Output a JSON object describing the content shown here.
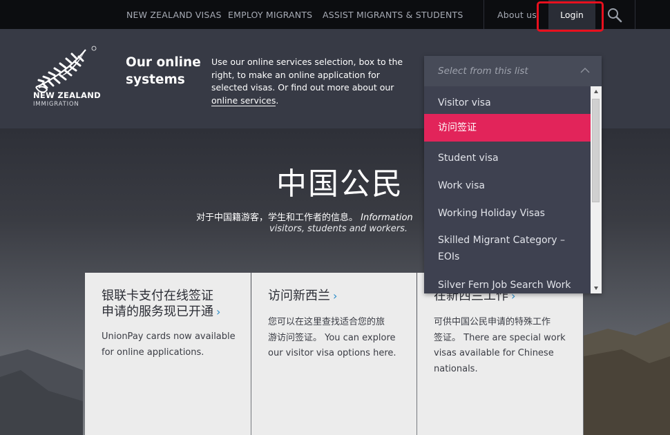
{
  "nav": {
    "links": [
      {
        "label": "NEW ZEALAND VISAS"
      },
      {
        "label": "EMPLOY MIGRANTS"
      },
      {
        "label": "ASSIST MIGRANTS & STUDENTS"
      }
    ],
    "about_label": "About us",
    "login_label": "Login",
    "search_icon": "search-icon"
  },
  "logo": {
    "line1": "NEW ZEALAND",
    "line2": "IMMIGRATION",
    "icon": "fern-icon"
  },
  "online": {
    "title_line1": "Our online",
    "title_line2": "systems",
    "desc_text": "Use our online services selection, box to the right, to make an online application for selected visas. Or find out more about our ",
    "desc_link": "online services",
    "desc_end": "."
  },
  "hero": {
    "title": "中国公民",
    "subtitle_cn": "对于中国籍游客，学生和工作者的信息。",
    "subtitle_en": "Information",
    "subtitle_en2": "visitors, students and workers."
  },
  "dropdown": {
    "placeholder": "Select from this list",
    "items": [
      {
        "label": "Visitor visa"
      },
      {
        "label": "访问签证"
      },
      {
        "label": "Student visa"
      },
      {
        "label": "Work visa"
      },
      {
        "label": "Working Holiday Visas"
      },
      {
        "label": "Skilled Migrant Category –"
      },
      {
        "label": "EOIs"
      },
      {
        "label": "Silver Fern Job Search Work"
      }
    ],
    "selected_index": 1
  },
  "cards": [
    {
      "title_line1": "银联卡支付在线签证",
      "title_line2": "申请的服务现已开通",
      "body_lines": [
        "UnionPay cards now available",
        "for online applications."
      ]
    },
    {
      "title_line1": "访问新西兰",
      "body_lines": [
        "您可以在这里查找适合您的旅",
        "游访问签证。 You can explore",
        "our visitor visa options here."
      ]
    },
    {
      "title_line1": "在新西兰工作",
      "body_lines": [
        "可供中国公民申请的特殊工作",
        "签证。 There are special work",
        "visas available for Chinese",
        "nationals."
      ]
    }
  ],
  "colors": {
    "topbar": "#0c0d10",
    "header": "#373a45",
    "selected": "#e2245a",
    "chevron": "#2a8cc9",
    "highlight": "#e8101e"
  }
}
